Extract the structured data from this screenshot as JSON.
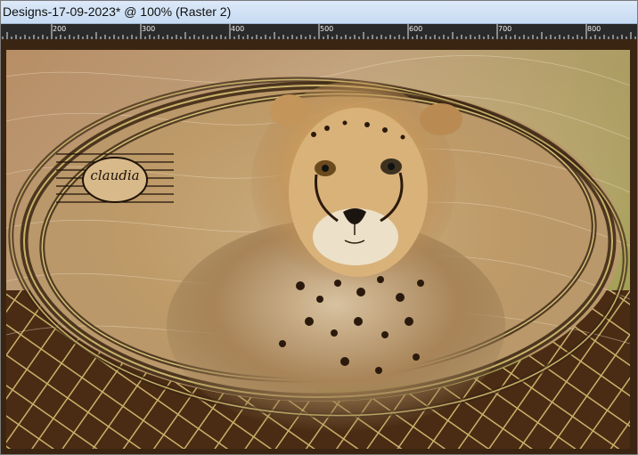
{
  "window": {
    "title": "Designs-17-09-2023* @ 100% (Raster 2)"
  },
  "ruler": {
    "labels": [
      "200",
      "300",
      "400",
      "500",
      "600",
      "700",
      "800"
    ]
  },
  "canvas": {
    "watermark_text": "claudia",
    "colors": {
      "frame_brown": "#3a2512",
      "lattice_gold": "#c9b26a",
      "background_gradient_start": "#b78e66",
      "background_gradient_end": "#8d9a3c"
    }
  }
}
